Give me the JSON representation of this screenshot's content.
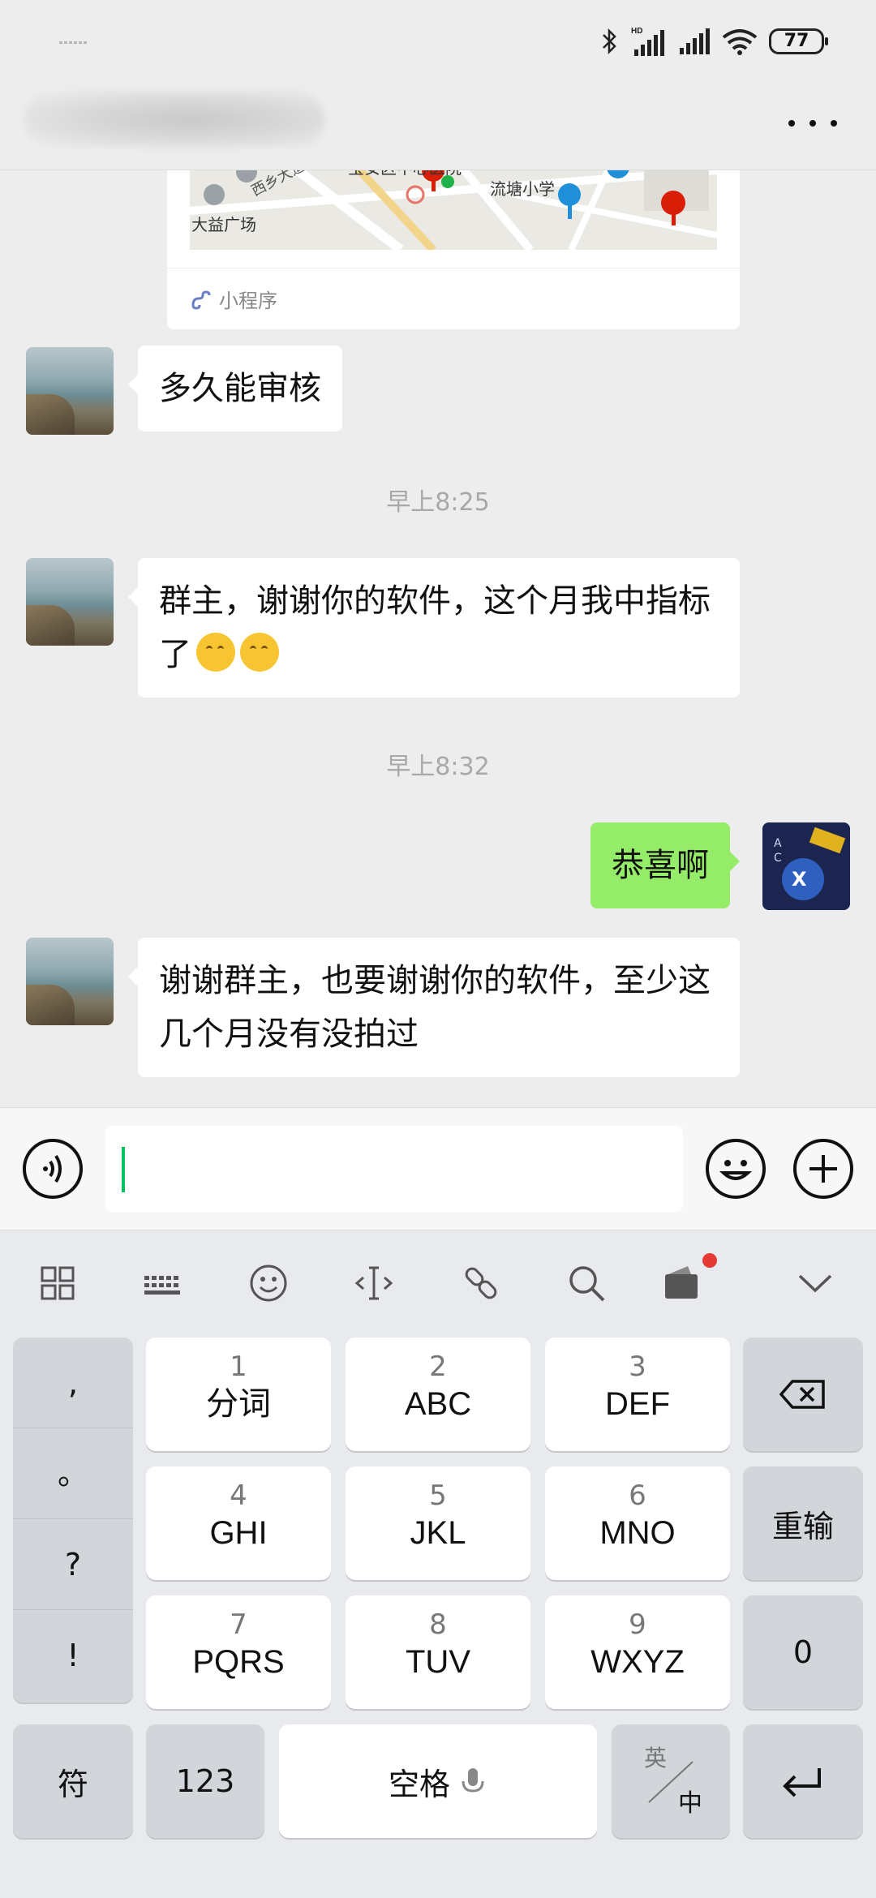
{
  "status_bar": {
    "battery": "77",
    "network_label": "HD"
  },
  "header": {
    "title_blurred": true,
    "more_icon": "more-dots-icon"
  },
  "mini_program_card": {
    "map_labels": [
      "宝安区中心医院",
      "西乡大道",
      "流塘小学",
      "大益广场"
    ],
    "footer_label": "小程序"
  },
  "messages": [
    {
      "side": "left",
      "text": "多久能审核"
    },
    {
      "type": "time",
      "text": "早上8:25"
    },
    {
      "side": "left",
      "text": "群主，谢谢你的软件，这个月我中指标了",
      "emojis": 2
    },
    {
      "type": "time",
      "text": "早上8:32"
    },
    {
      "side": "right",
      "text": "恭喜啊"
    },
    {
      "side": "left",
      "text": "谢谢群主，也要谢谢你的软件，至少这几个月没有没拍过"
    }
  ],
  "input_bar": {
    "voice_icon": "voice-icon",
    "emoji_icon": "emoji-icon",
    "plus_icon": "plus-icon",
    "value": ""
  },
  "keyboard": {
    "toolbar_icons": [
      "grid-icon",
      "keyboard-icon",
      "smile-icon",
      "cursor-icon",
      "link-icon",
      "search-icon",
      "wallet-icon",
      "chevron-down-icon"
    ],
    "punct": [
      ",",
      "。",
      "?",
      "!"
    ],
    "keys": [
      {
        "num": "1",
        "letters": "分词"
      },
      {
        "num": "2",
        "letters": "ABC"
      },
      {
        "num": "3",
        "letters": "DEF"
      },
      {
        "num": "4",
        "letters": "GHI"
      },
      {
        "num": "5",
        "letters": "JKL"
      },
      {
        "num": "6",
        "letters": "MNO"
      },
      {
        "num": "7",
        "letters": "PQRS"
      },
      {
        "num": "8",
        "letters": "TUV"
      },
      {
        "num": "9",
        "letters": "WXYZ"
      }
    ],
    "reinput": "重输",
    "zero": "0",
    "symbols": "符",
    "numbers": "123",
    "space": "空格",
    "lang_top": "英",
    "lang_bottom": "中"
  }
}
